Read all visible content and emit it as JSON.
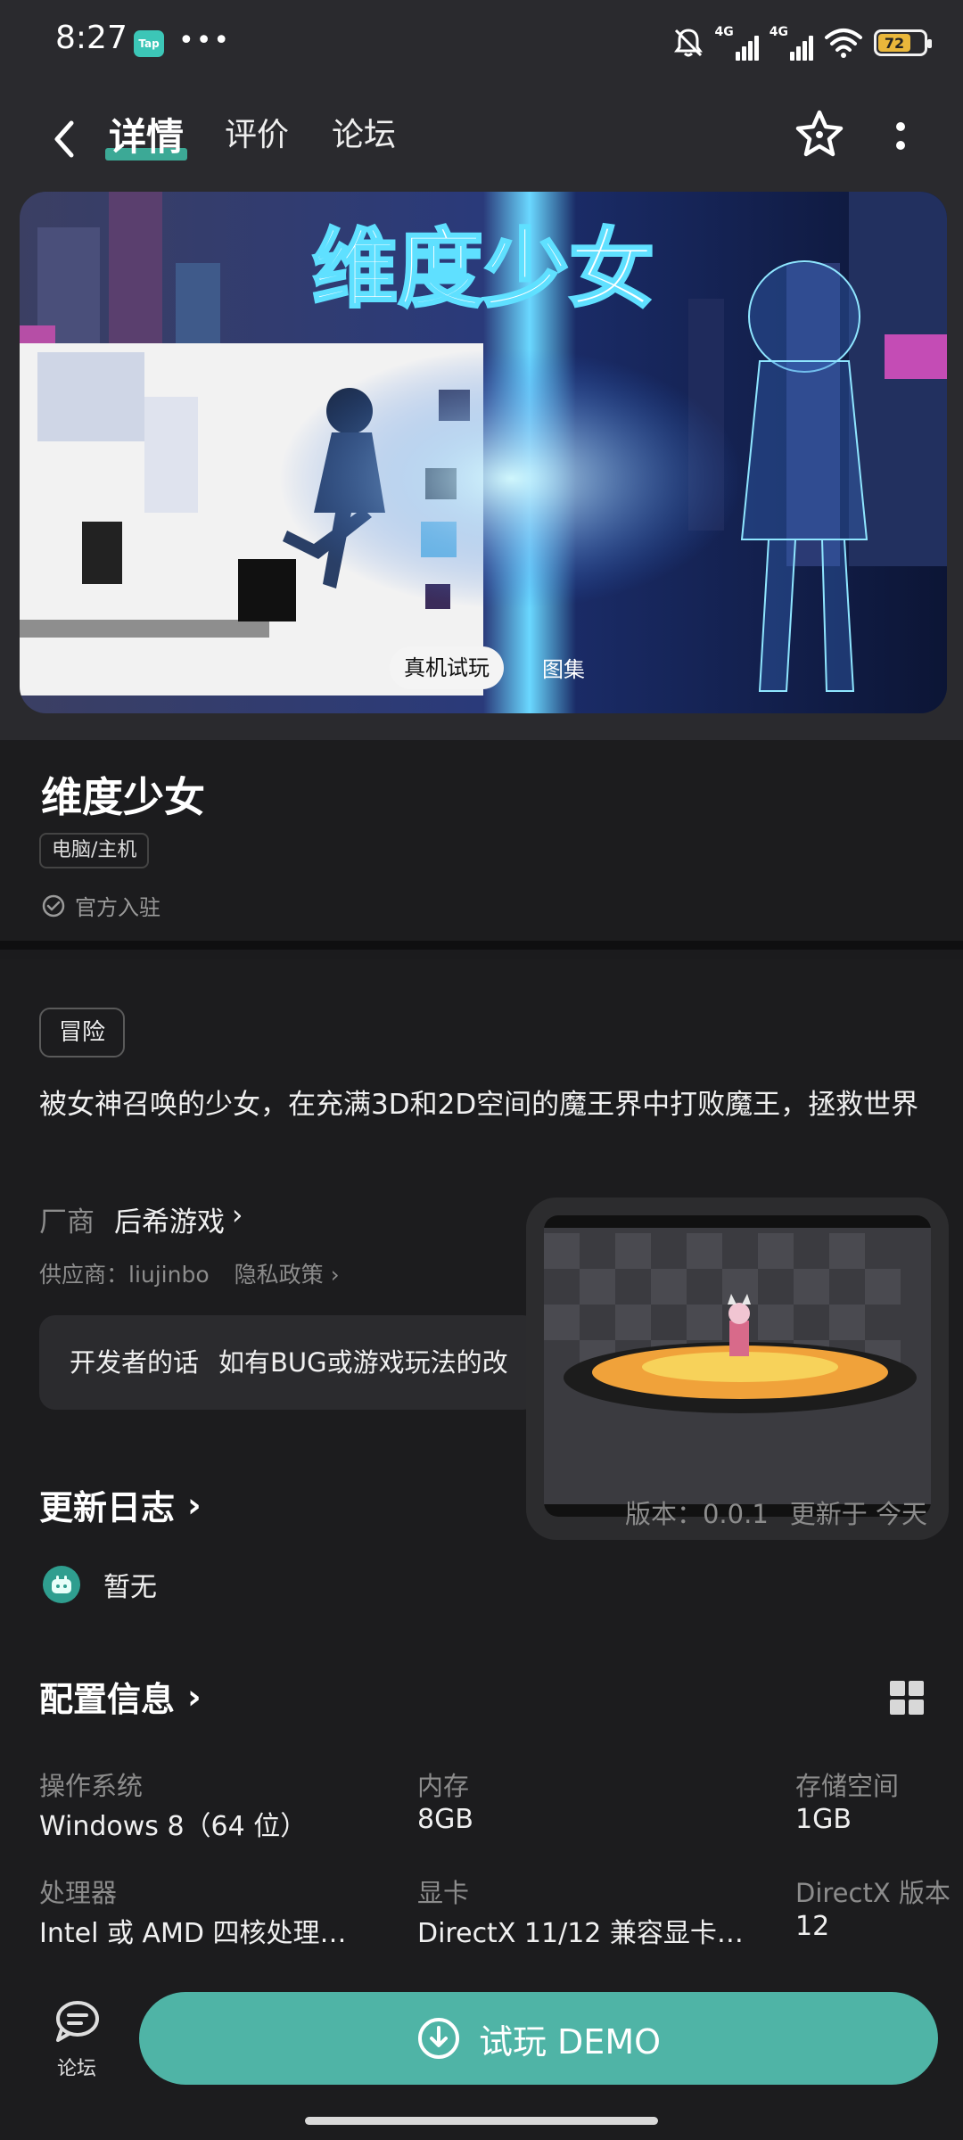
{
  "status_bar": {
    "time": "8:27",
    "app_badge": "Tap",
    "more": "•••",
    "signal1_label": "4G",
    "signal2_label": "4G",
    "battery_level": "72"
  },
  "nav": {
    "tabs": [
      {
        "label": "详情",
        "active": true
      },
      {
        "label": "评价",
        "active": false
      },
      {
        "label": "论坛",
        "active": false
      }
    ],
    "accent_color": "#3fbfa8"
  },
  "banner": {
    "art_title": "维度少女",
    "demo_chip": "真机试玩",
    "gallery_label": "图集"
  },
  "game": {
    "title": "维度少女",
    "platform_tag": "电脑/主机",
    "official_label": "官方入驻",
    "genre_tag": "冒险",
    "description": "被女神召唤的少女，在充满3D和2D空间的魔王界中打败魔王，拯救世界",
    "vendor_label": "厂商",
    "vendor_name": "后希游戏",
    "supplier": "供应商：liujinbo",
    "privacy": "隐私政策",
    "developer_label": "开发者的话",
    "developer_text": "如有BUG或游戏玩法的改"
  },
  "changelog": {
    "title": "更新日志",
    "version": "版本：0.0.1",
    "updated": "更新于 今天",
    "entry": "暂无"
  },
  "config": {
    "title": "配置信息",
    "specs": [
      {
        "label": "操作系统",
        "value": "Windows 8（64 位）"
      },
      {
        "label": "内存",
        "value": "8GB"
      },
      {
        "label": "存储空间",
        "value": "1GB"
      },
      {
        "label": "处理器",
        "value": "Intel 或 AMD 四核处理…"
      },
      {
        "label": "显卡",
        "value": "DirectX 11/12 兼容显卡…"
      },
      {
        "label": "DirectX 版本",
        "value": "12"
      }
    ]
  },
  "bottom": {
    "forum_label": "论坛",
    "demo_button": "试玩 DEMO",
    "button_color": "#4fb4a6"
  }
}
